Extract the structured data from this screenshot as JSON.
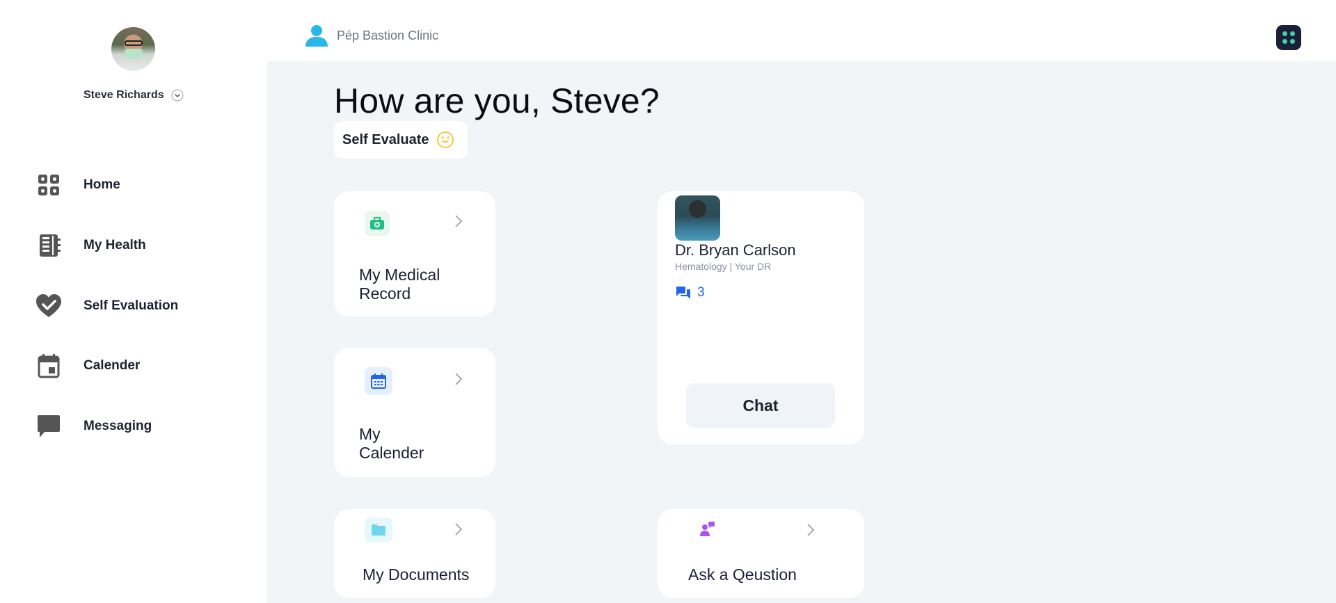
{
  "user": {
    "name": "Steve Richards"
  },
  "nav": {
    "items": [
      {
        "label": "Home",
        "icon": "grid-icon"
      },
      {
        "label": "My Health",
        "icon": "notebook-icon"
      },
      {
        "label": "Self Evaluation",
        "icon": "heart-check-icon"
      },
      {
        "label": "Calender",
        "icon": "calendar-icon"
      },
      {
        "label": "Messaging",
        "icon": "chat-bubble-icon"
      }
    ]
  },
  "topbar": {
    "clinic_name": "Pép Bastion Clinic"
  },
  "main": {
    "greeting": "How are you, Steve?",
    "self_evaluate_label": "Self Evaluate",
    "cards": {
      "medical_record": {
        "title_line1": "My Medical",
        "title_line2": "Record"
      },
      "calender": {
        "title_line1": "My",
        "title_line2": "Calender"
      },
      "documents": {
        "title": "My Documents"
      },
      "ask_question": {
        "title": "Ask a Qeustion"
      }
    },
    "doctor": {
      "name": "Dr. Bryan Carlson",
      "subtitle": "Hematology | Your DR",
      "message_count": "3",
      "chat_label": "Chat"
    }
  },
  "colors": {
    "accent_blue": "#2563eb",
    "clinic_icon": "#29b6e8",
    "apps_button_bg": "#1b1f3a",
    "apps_button_dots": "#3fd3a3",
    "medical_icon": "#1fbf86",
    "calendar_icon": "#2563eb",
    "documents_icon": "#6fd6ee",
    "ask_icon": "#a855f7",
    "smiley": "#f3c93b"
  }
}
